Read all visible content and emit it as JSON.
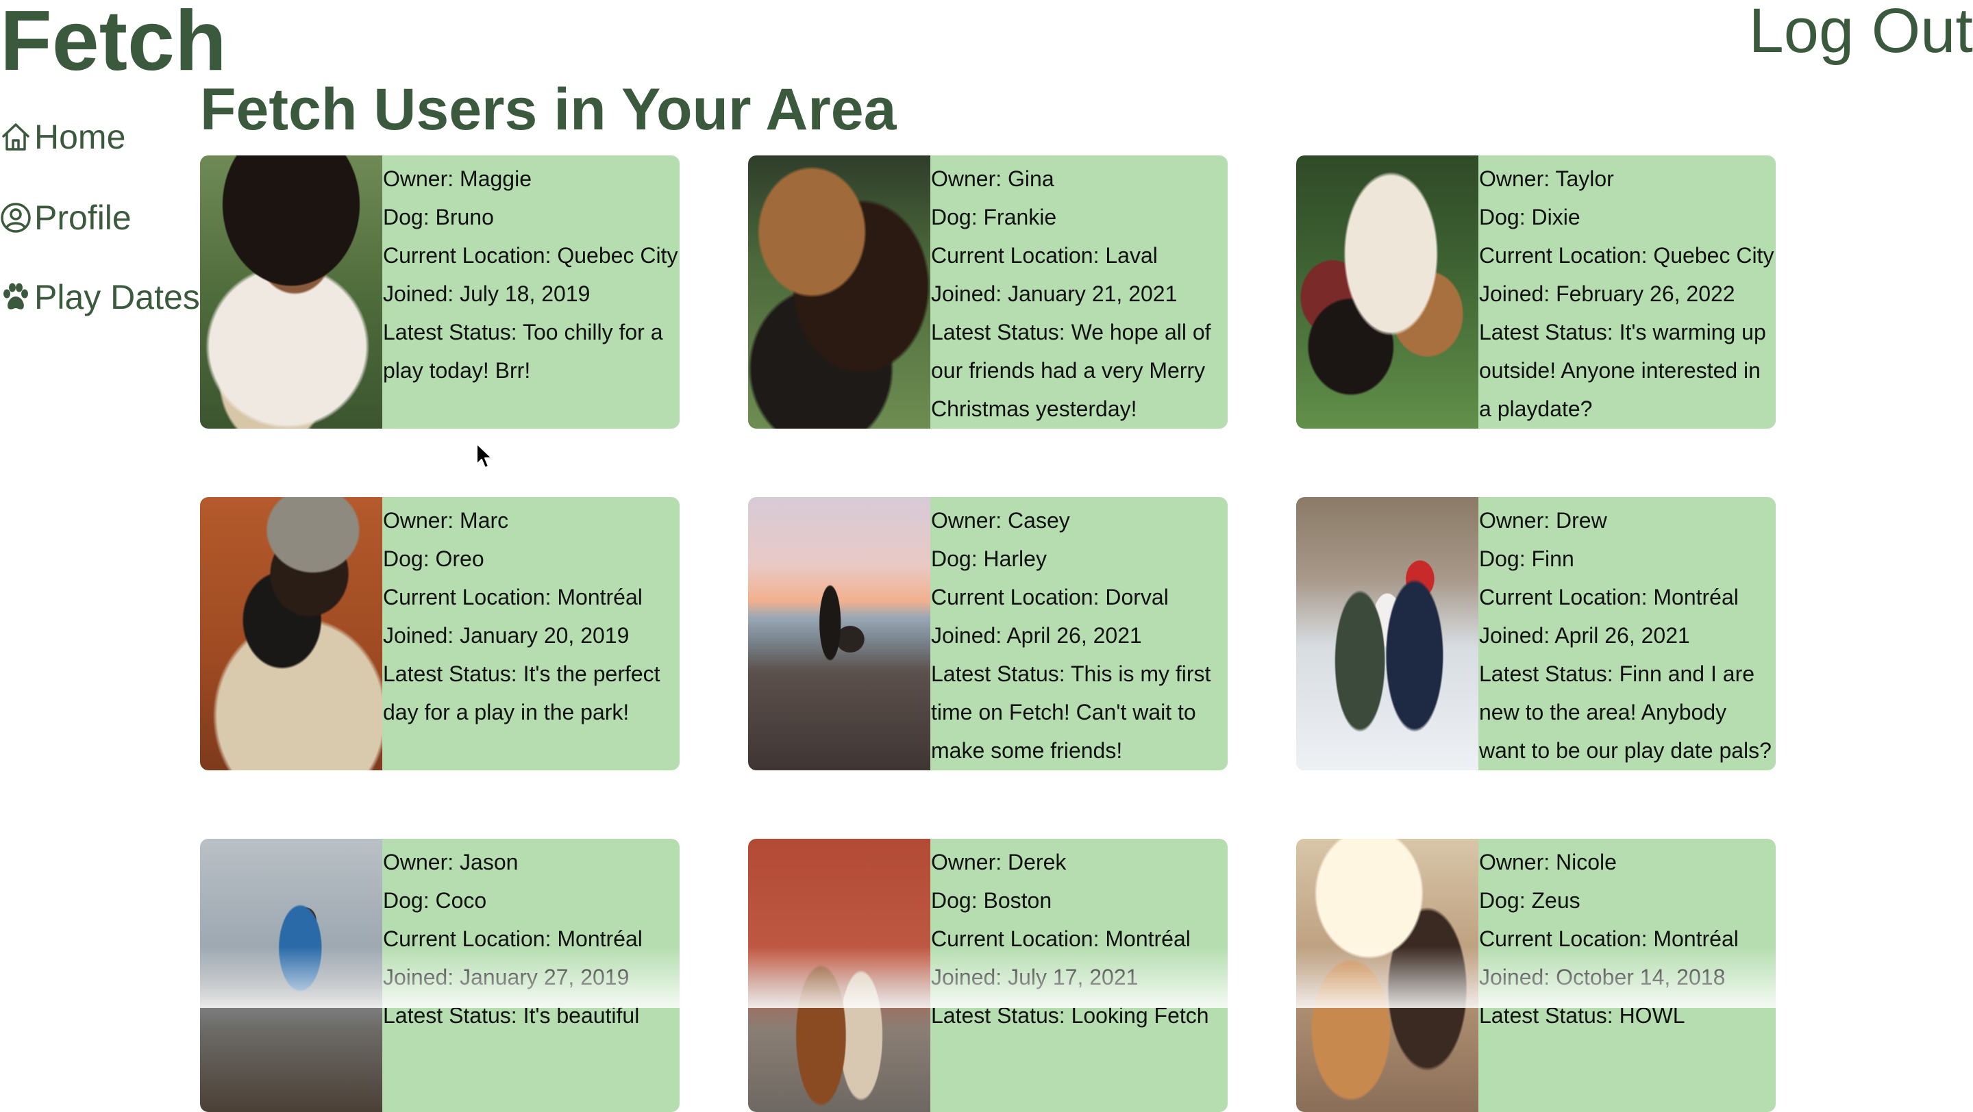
{
  "app": {
    "logo": "Fetch",
    "logout_label": "Log Out"
  },
  "nav": {
    "items": [
      {
        "label": "Home",
        "icon": "home-icon"
      },
      {
        "label": "Profile",
        "icon": "user-circle-icon"
      },
      {
        "label": "Play Dates",
        "icon": "paw-icon"
      }
    ]
  },
  "main": {
    "title": "Fetch Users in Your Area"
  },
  "colors": {
    "brand": "#3b5a3d",
    "card": "#b5ddb0",
    "text": "#111111"
  },
  "labels": {
    "owner": "Owner:",
    "dog": "Dog:",
    "location": "Current Location:",
    "joined": "Joined:",
    "status": "Latest Status:"
  },
  "users": [
    {
      "owner": "Maggie",
      "dog": "Bruno",
      "location": "Quebec City",
      "joined": "July 18, 2019",
      "status": "Too chilly for a play today! Brr!",
      "photo": "woman with afro hugging white dog on grass"
    },
    {
      "owner": "Gina",
      "dog": "Frankie",
      "location": "Laval",
      "joined": "January 21, 2021",
      "status": "We hope all of our friends had a very Merry Christmas yesterday!",
      "photo": "woman hugging brown dog"
    },
    {
      "owner": "Taylor",
      "dog": "Dixie",
      "location": "Quebec City",
      "joined": "February 26, 2022",
      "status": "It's warming up outside! Anyone interested in a playdate?",
      "photo": "woman sitting on grass with dogs"
    },
    {
      "owner": "Marc",
      "dog": "Oreo",
      "location": "Montréal",
      "joined": "January 20, 2019",
      "status": "It's the perfect day for a play in the park!",
      "photo": "man in beanie holding french bulldog"
    },
    {
      "owner": "Casey",
      "dog": "Harley",
      "location": "Dorval",
      "joined": "April 26, 2021",
      "status": "This is my first time on Fetch! Can't wait to make some friends!",
      "photo": "person walking dog on beach at sunset"
    },
    {
      "owner": "Drew",
      "dog": "Finn",
      "location": "Montréal",
      "joined": "April 26, 2021",
      "status": "Finn and I are new to the area! Anybody want to be our play date pals?",
      "photo": "couple with dog in snowy forest"
    },
    {
      "owner": "Jason",
      "dog": "Coco",
      "location": "Montréal",
      "joined": "January 27, 2019",
      "status": "It's beautiful",
      "photo": "hiker on mountain ridge"
    },
    {
      "owner": "Derek",
      "dog": "Boston",
      "location": "Montréal",
      "joined": "July 17, 2021",
      "status": "Looking Fetch",
      "photo": "couple walking on city street"
    },
    {
      "owner": "Nicole",
      "dog": "Zeus",
      "location": "Montréal",
      "joined": "October 14, 2018",
      "status": "HOWL",
      "photo": "woman kissing dog in sunlight"
    }
  ]
}
